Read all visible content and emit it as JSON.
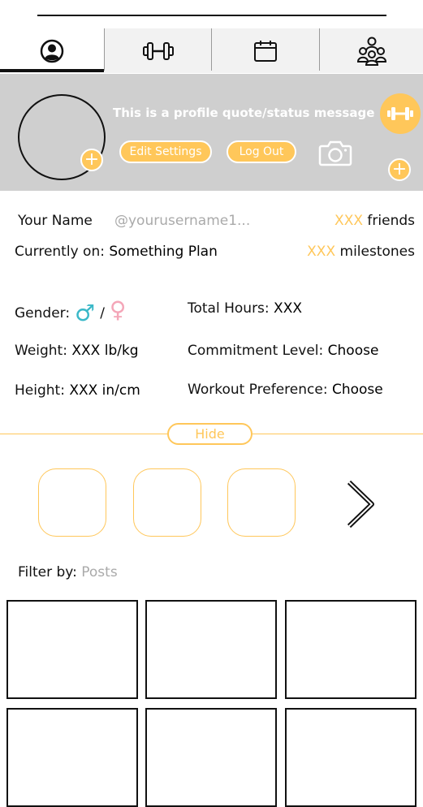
{
  "tabs": [
    {
      "icon": "profile-icon"
    },
    {
      "icon": "dumbbell-icon"
    },
    {
      "icon": "calendar-icon"
    },
    {
      "icon": "community-icon"
    }
  ],
  "header": {
    "quote": "This is a profile quote/status message",
    "edit_settings": "Edit Settings",
    "log_out": "Log Out",
    "plus": "+"
  },
  "profile": {
    "name": "Your Name",
    "username": "@yourusername1...",
    "friends_count": "XXX",
    "friends_label": "friends",
    "plan_label": "Currently on:",
    "plan_value": "Something Plan",
    "milestones_count": "XXX",
    "milestones_label": "milestones"
  },
  "stats": {
    "gender_label": "Gender:",
    "gender_sep": "/",
    "male_symbol": "♂",
    "female_symbol": "♀",
    "weight_label": "Weight:",
    "weight_value": "XXX lb/kg",
    "height_label": "Height:",
    "height_value": "XXX in/cm",
    "hours_label": "Total Hours:",
    "hours_value": "XXX",
    "commitment_label": "Commitment Level:",
    "commitment_value": "Choose",
    "preference_label": "Workout Preference:",
    "preference_value": "Choose"
  },
  "hide_label": "Hide",
  "filter": {
    "label": "Filter by:",
    "value": "Posts"
  },
  "colors": {
    "accent": "#ffc75a",
    "male": "#3ab8c8",
    "female": "#f4a6b8",
    "header_bg": "#cfcfcf"
  }
}
